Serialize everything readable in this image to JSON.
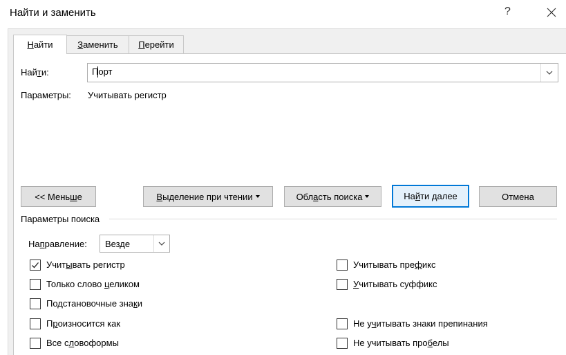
{
  "window": {
    "title": "Найти и заменить",
    "help_label": "?"
  },
  "tabs": [
    {
      "pre": "",
      "u": "Н",
      "post": "айти",
      "active": true
    },
    {
      "pre": "",
      "u": "З",
      "post": "аменить",
      "active": false
    },
    {
      "pre": "",
      "u": "П",
      "post": "ерейти",
      "active": false
    }
  ],
  "find": {
    "label_pre": "Най",
    "label_u": "т",
    "label_post": "и:",
    "value": "Порт",
    "params_label": "Параметры:",
    "params_value": "Учитывать регистр"
  },
  "buttons": {
    "less": {
      "pre": "<< Мень",
      "u": "ш",
      "post": "е"
    },
    "reading_highlight": {
      "pre": "",
      "u": "В",
      "post": "ыделение при чтении"
    },
    "search_in": {
      "pre": "Обл",
      "u": "а",
      "post": "сть поиска"
    },
    "find_next": {
      "pre": "На",
      "u": "й",
      "post": "ти далее"
    },
    "cancel": "Отмена"
  },
  "search_options": {
    "group_label": "Параметры поиска",
    "direction_label_pre": "На",
    "direction_label_u": "п",
    "direction_label_post": "равление:",
    "direction_value": "Везде",
    "left": [
      {
        "pre": "Учит",
        "u": "ы",
        "post": "вать регистр",
        "checked": true
      },
      {
        "pre": "Только слово ",
        "u": "ц",
        "post": "еликом",
        "checked": false
      },
      {
        "pre": "Подстановочные зна",
        "u": "к",
        "post": "и",
        "checked": false
      },
      {
        "pre": "П",
        "u": "р",
        "post": "оизносится как",
        "checked": false
      },
      {
        "pre": "Все с",
        "u": "л",
        "post": "овоформы",
        "checked": false
      }
    ],
    "right": [
      {
        "pre": "Учитывать пре",
        "u": "ф",
        "post": "икс",
        "checked": false
      },
      {
        "pre": "",
        "u": "У",
        "post": "читывать суффикс",
        "checked": false
      },
      {
        "pre": "Не у",
        "u": "ч",
        "post": "итывать знаки препинания",
        "checked": false
      },
      {
        "pre": "Не учитывать про",
        "u": "б",
        "post": "елы",
        "checked": false
      }
    ]
  }
}
